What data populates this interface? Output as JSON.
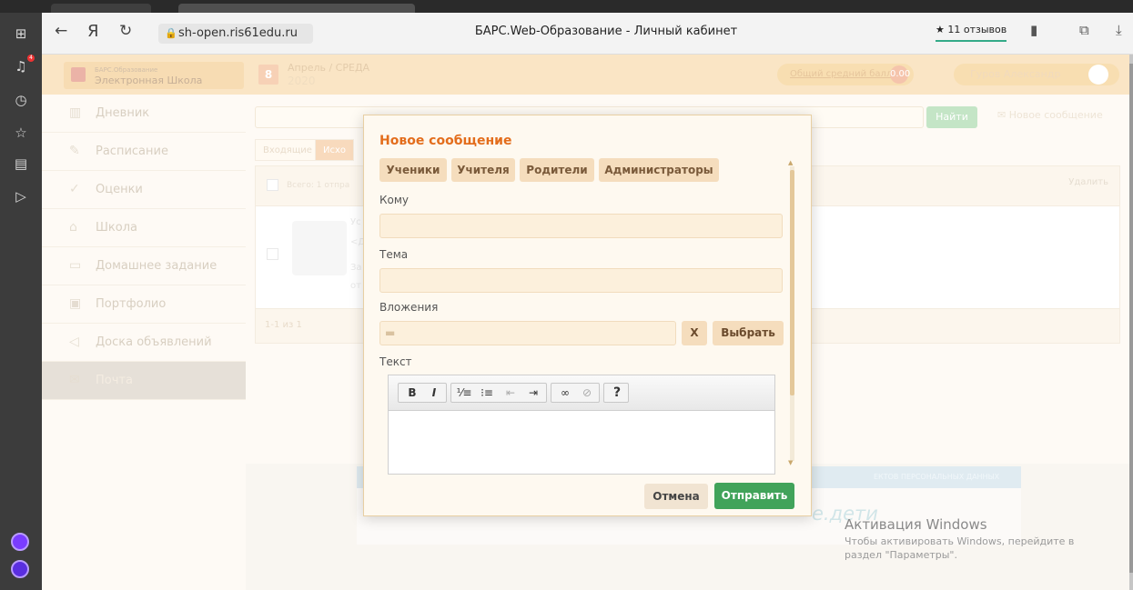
{
  "browser": {
    "url": "sh-open.ris61edu.ru",
    "title": "БАРС.Web-Образование - Личный кабинет",
    "reviews": "11 отзывов",
    "side_icons": [
      "apps-icon",
      "bell-icon",
      "clock-icon",
      "star-icon",
      "notes-icon",
      "play-icon"
    ],
    "badge_count": "4"
  },
  "header": {
    "logo_top": "БАРС.Образование",
    "logo_main": "Электронная Школа",
    "day_number": "8",
    "month_day": "Апрель / СРЕДА",
    "year": "2020",
    "avg_label": "Общий средний балл",
    "avg_value": "0.00",
    "user_name": "Гуров Александр"
  },
  "menu": [
    {
      "label": "Дневник",
      "icon": "book-icon"
    },
    {
      "label": "Расписание",
      "icon": "pencil-icon"
    },
    {
      "label": "Оценки",
      "icon": "check-icon"
    },
    {
      "label": "Школа",
      "icon": "building-icon"
    },
    {
      "label": "Домашнее задание",
      "icon": "chat-icon"
    },
    {
      "label": "Портфолио",
      "icon": "briefcase-icon"
    },
    {
      "label": "Доска объявлений",
      "icon": "megaphone-icon"
    },
    {
      "label": "Почта",
      "icon": "mail-icon"
    }
  ],
  "mail": {
    "find_label": "Найти",
    "new_message_label": "Новое сообщение",
    "tabs": [
      "Входящие",
      "Исхо"
    ],
    "total_label": "Всего: 1 отпра",
    "delete_label": "Удалить",
    "row_lines": [
      "Ус",
      "<Д",
      "За",
      "от"
    ],
    "pager": "1-1 из 1"
  },
  "footer": {
    "banner_text": "ЕКТОВ ПЕРСОНАЛЬНЫХ ДАННЫХ",
    "brand": "е.дети"
  },
  "modal": {
    "title": "Новое сообщение",
    "recipient_buttons": [
      "Ученики",
      "Учителя",
      "Родители",
      "Администраторы"
    ],
    "to_label": "Кому",
    "subject_label": "Тема",
    "attach_label": "Вложения",
    "remove_label": "X",
    "choose_label": "Выбрать",
    "text_label": "Текст",
    "cancel_label": "Отмена",
    "send_label": "Отправить"
  },
  "windows": {
    "title": "Активация Windows",
    "line1": "Чтобы активировать Windows, перейдите в",
    "line2": "раздел \"Параметры\"."
  },
  "colors": {
    "accent": "#e36d1c",
    "send_green": "#41a35a",
    "header_bg": "#f7d8a6"
  }
}
